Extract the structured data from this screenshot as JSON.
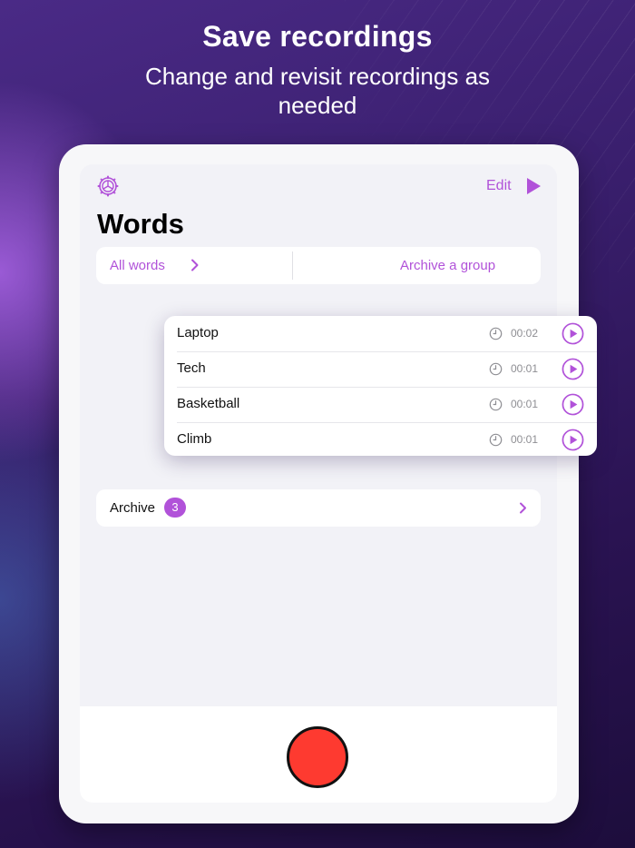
{
  "promo": {
    "headline": "Save recordings",
    "subline": "Change and revisit recordings as needed"
  },
  "nav": {
    "settings_icon": "gear-icon",
    "edit_label": "Edit",
    "play_icon": "play-triangle-icon"
  },
  "page": {
    "title": "Words"
  },
  "segment": {
    "left_label": "All words",
    "right_label": "Archive a group"
  },
  "words": [
    {
      "name": "Laptop",
      "duration": "00:02"
    },
    {
      "name": "Tech",
      "duration": "00:01"
    },
    {
      "name": "Basketball",
      "duration": "00:01"
    },
    {
      "name": "Climb",
      "duration": "00:01"
    }
  ],
  "archive": {
    "label": "Archive",
    "count": "3"
  },
  "colors": {
    "accent": "#b152d9",
    "record": "#fe3a30",
    "screen_bg": "#f2f2f7"
  }
}
